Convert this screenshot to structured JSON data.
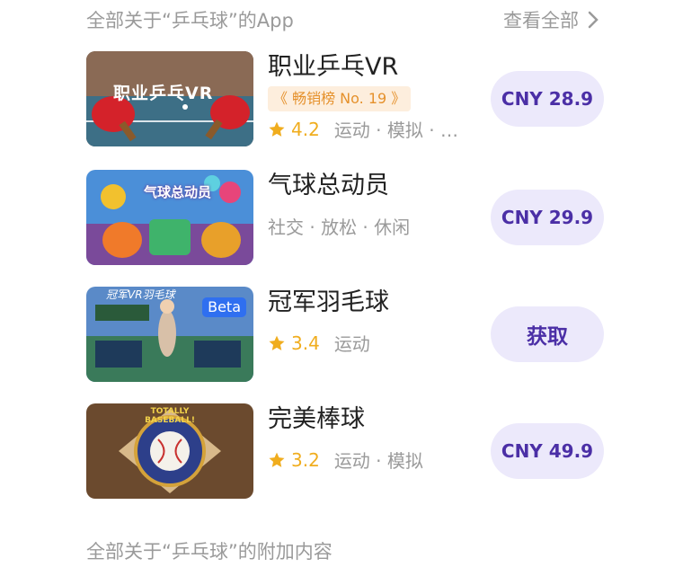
{
  "header": {
    "title": "全部关于“乒乓球”的App",
    "see_all": "查看全部"
  },
  "apps": [
    {
      "name": "职业乒乓VR",
      "badge": "《 畅销榜 No. 19 》",
      "rating": "4.2",
      "tags": "运动 · 模拟 · …",
      "price": "CNY 28.9",
      "thumb_text": "职业乒乓VR"
    },
    {
      "name": "气球总动员",
      "tags": "社交 · 放松 · 休闲",
      "price": "CNY 29.9",
      "thumb_text": "气球总动员"
    },
    {
      "name": "冠军羽毛球",
      "rating": "3.4",
      "tags": "运动",
      "price": "获取",
      "thumb_text": "冠军VR羽毛球",
      "thumb_badge": "Beta"
    },
    {
      "name": "完美棒球",
      "rating": "3.2",
      "tags": "运动 · 模拟",
      "price": "CNY 49.9",
      "thumb_text": "TOTALLY BASEBALL!"
    }
  ],
  "footer": {
    "title": "全部关于“乒乓球”的附加内容"
  },
  "colors": {
    "accent": "#4b2fa6",
    "button_bg": "#ece9fb",
    "star": "#f0ad1e",
    "muted": "#9a9a9a"
  }
}
